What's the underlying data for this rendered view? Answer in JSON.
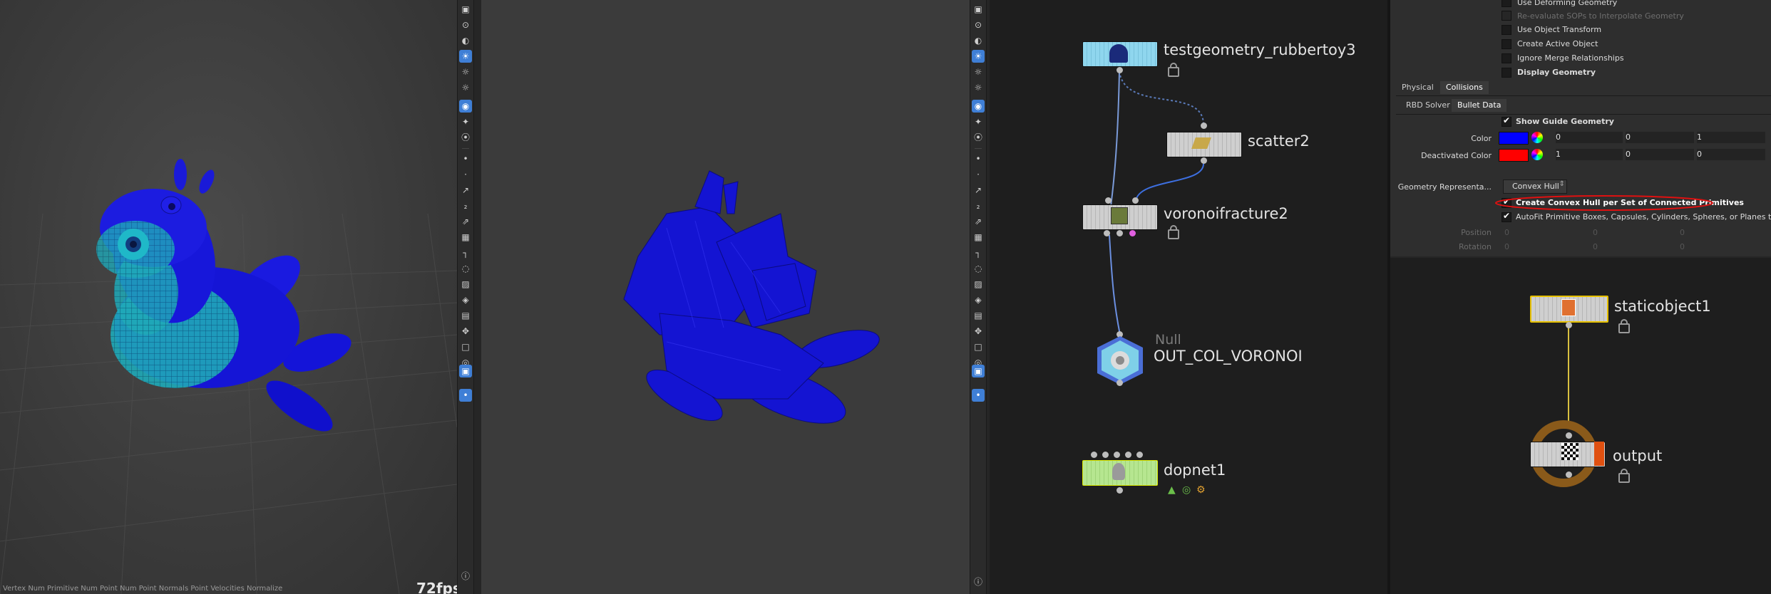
{
  "viewport_left": {
    "status_text": "Vertex Num   Primitive Num   Point Num   Point Normals   Point Velocities   Normalize",
    "fps": "72fps"
  },
  "network_left": {
    "nodes": [
      {
        "name": "testgeometry_rubbertoy3"
      },
      {
        "name": "scatter2"
      },
      {
        "name": "voronoifracture2"
      },
      {
        "type_label": "Null",
        "name": "OUT_COL_VORONOI"
      },
      {
        "name": "dopnet1"
      }
    ]
  },
  "params": {
    "top_options": [
      {
        "label": "Use Deforming Geometry",
        "checked": false,
        "dim": false
      },
      {
        "label": "Re-evaluate SOPs to Interpolate Geometry",
        "checked": false,
        "dim": true
      },
      {
        "label": "Use Object Transform",
        "checked": false,
        "dim": false
      },
      {
        "label": "Create Active Object",
        "checked": false,
        "dim": false
      },
      {
        "label": "Ignore Merge Relationships",
        "checked": false,
        "dim": false
      },
      {
        "label": "Display Geometry",
        "checked": false,
        "dim": false,
        "bold": true
      }
    ],
    "tabs": [
      "Physical",
      "Collisions"
    ],
    "subtabs": [
      "RBD Solver",
      "Bullet Data"
    ],
    "show_guide": "Show Guide Geometry",
    "color_label": "Color",
    "color_values": [
      "0",
      "0",
      "1"
    ],
    "deactivated_label": "Deactivated Color",
    "deactivated_values": [
      "1",
      "0",
      "0"
    ],
    "geo_rep_label": "Geometry Representa...",
    "geo_rep_value": "Convex Hull",
    "convex_option": "Create Convex Hull per Set of Connected Primitives",
    "autofit_option": "AutoFit Primitive Boxes, Capsules, Cylinders, Spheres, or Planes to...",
    "position_label": "Position",
    "rotation_label": "Rotation",
    "position_values": [
      "0",
      "0",
      "0"
    ],
    "rotation_values": [
      "0",
      "0",
      "0"
    ],
    "colors": {
      "guide": "#0000ff",
      "deactivated": "#ff0000",
      "annotation": "#e01010"
    }
  },
  "network_right": {
    "nodes": [
      {
        "name": "staticobject1"
      },
      {
        "name": "output"
      }
    ]
  }
}
